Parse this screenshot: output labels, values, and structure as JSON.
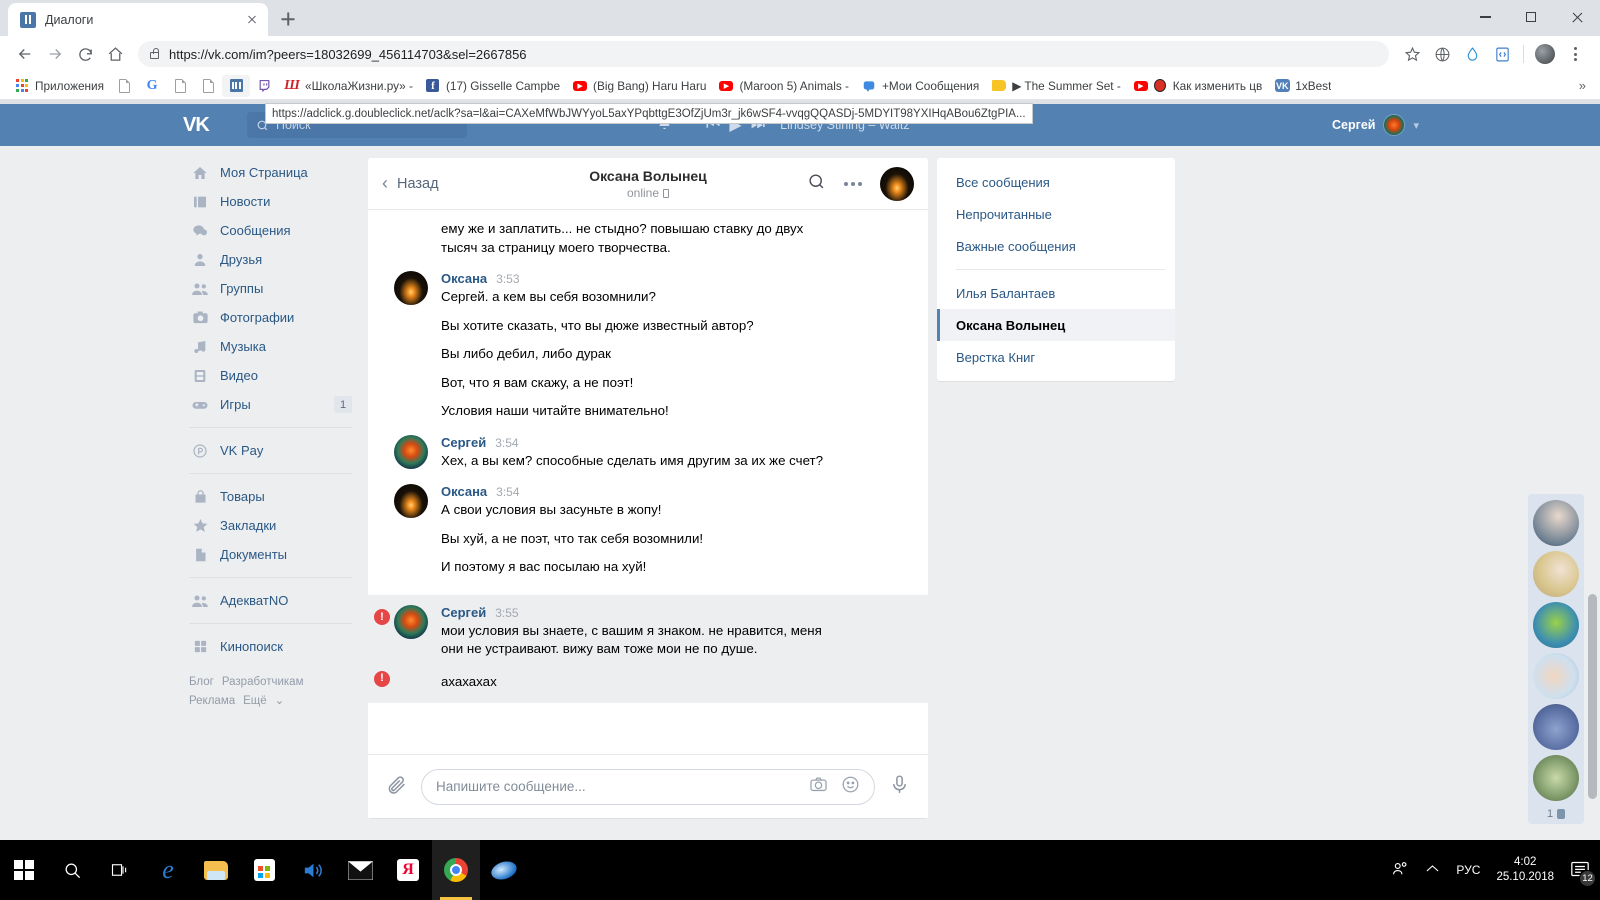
{
  "browser": {
    "tab": {
      "title": "Диалоги",
      "favicon": "vk-favicon"
    },
    "new_tab_label": "+",
    "url": "https://vk.com/im?peers=18032699_456114703&sel=2667856",
    "link_preview": "https://adclick.g.doubleclick.net/aclk?sa=l&ai=CAXeMfWbJWYyoL5axYPqbttgE3OfZjUm3r_jk6wSF4-vvqgQQASDj-5MDYIT98YXIHqABou6ZtgPIA...",
    "window_controls": {
      "minimize": "minimize-icon",
      "maximize": "maximize-icon",
      "close": "close-icon"
    },
    "bookmarks": [
      {
        "label": "Приложения",
        "icon": "apps-grid-icon"
      },
      {
        "label": "",
        "icon": "doc-icon"
      },
      {
        "label": "",
        "icon": "google-icon"
      },
      {
        "label": "",
        "icon": "doc-icon"
      },
      {
        "label": "",
        "icon": "doc-icon"
      },
      {
        "label": "",
        "icon": "vk-blue-icon"
      },
      {
        "label": "",
        "icon": "twitch-icon"
      },
      {
        "label": "«ШколаЖизни.ру» -",
        "icon": "shkolazhizni-icon"
      },
      {
        "label": "(17) Gisselle Campbe",
        "icon": "facebook-icon"
      },
      {
        "label": "(Big Bang) Haru Haru",
        "icon": "youtube-icon"
      },
      {
        "label": "(Maroon 5) Animals -",
        "icon": "youtube-icon"
      },
      {
        "label": "+Мои Сообщения",
        "icon": "message-icon"
      },
      {
        "label": "▶ The Summer Set -",
        "icon": "folder-icon"
      },
      {
        "label": "Как изменить цв",
        "icon": "youtube-icon"
      },
      {
        "label": "1xBest",
        "icon": "vk-icon"
      }
    ],
    "toolbar_icons": [
      "back-icon",
      "forward-icon",
      "reload-icon",
      "home-icon",
      "star-icon",
      "globe-icon",
      "droplet-icon",
      "code-icon",
      "profile-avatar",
      "menu-dots-icon"
    ]
  },
  "vk": {
    "header": {
      "logo": "vk-logo",
      "search_placeholder": "Поиск",
      "notifications_icon": "bell-icon",
      "player": {
        "prev": "prev-icon",
        "play": "play-icon",
        "next": "next-icon",
        "track": "Lindsey Stirling – Waltz"
      },
      "user_name": "Сергей",
      "user_chevron": "chevron-down-icon"
    },
    "left_nav": {
      "items": [
        {
          "label": "Моя Страница",
          "icon": "home-icon",
          "badge": ""
        },
        {
          "label": "Новости",
          "icon": "news-icon",
          "badge": ""
        },
        {
          "label": "Сообщения",
          "icon": "messages-icon",
          "badge": ""
        },
        {
          "label": "Друзья",
          "icon": "friends-icon",
          "badge": ""
        },
        {
          "label": "Группы",
          "icon": "groups-icon",
          "badge": ""
        },
        {
          "label": "Фотографии",
          "icon": "photos-icon",
          "badge": ""
        },
        {
          "label": "Музыка",
          "icon": "music-icon",
          "badge": ""
        },
        {
          "label": "Видео",
          "icon": "video-icon",
          "badge": ""
        },
        {
          "label": "Игры",
          "icon": "games-icon",
          "badge": "1"
        }
      ],
      "group2": [
        {
          "label": "VK Pay",
          "icon": "vkpay-icon",
          "badge": ""
        }
      ],
      "group3": [
        {
          "label": "Товары",
          "icon": "market-icon",
          "badge": ""
        },
        {
          "label": "Закладки",
          "icon": "bookmarks-star-icon",
          "badge": ""
        },
        {
          "label": "Документы",
          "icon": "documents-icon",
          "badge": ""
        }
      ],
      "group4": [
        {
          "label": "АдекватNO",
          "icon": "community-icon",
          "badge": ""
        }
      ],
      "group5": [
        {
          "label": "Кинопоиск",
          "icon": "apps-squares-icon",
          "badge": ""
        }
      ],
      "footer_links": [
        "Блог",
        "Разработчикам",
        "Реклама",
        "Ещё"
      ],
      "footer_chevron": "chevron-down-icon"
    },
    "chat": {
      "back_label": "Назад",
      "title": "Оксана Волынец",
      "status": "online",
      "status_device_icon": "mobile-icon",
      "search_icon": "search-icon",
      "more_icon": "more-dots-icon",
      "header_avatar": "oksana-avatar",
      "cut_message_top": "ему же и заплатить... не стыдно? повышаю ставку до двух",
      "cut_message_top2": "тысяч за страницу моего творчества.",
      "messages": [
        {
          "author": "Оксана",
          "time": "3:53",
          "avatar": "oksana-avatar",
          "highlight": false,
          "error": false,
          "lines": [
            "Сергей. а кем вы себя возомнили?",
            "Вы хотите сказать, что вы дюже известный автор?",
            "Вы либо дебил, либо дурак",
            "Вот, что я вам скажу, а не поэт!",
            "Условия наши читайте внимательно!"
          ]
        },
        {
          "author": "Сергей",
          "time": "3:54",
          "avatar": "sergey-avatar",
          "highlight": false,
          "error": false,
          "lines": [
            "Хех, а вы кем? способные сделать имя другим за их же счет?"
          ]
        },
        {
          "author": "Оксана",
          "time": "3:54",
          "avatar": "oksana-avatar",
          "highlight": false,
          "error": false,
          "lines": [
            "А свои условия вы засуньте в жопу!",
            "Вы хуй, а не поэт, что так себя возомнили!",
            "И поэтому я вас посылаю на хуй!"
          ]
        },
        {
          "author": "Сергей",
          "time": "3:55",
          "avatar": "sergey-avatar",
          "highlight": true,
          "error": true,
          "error_mark": "!",
          "lines": [
            "мои условия вы знаете, с вашим я знаком. не нравится, меня",
            "они не устраивают. вижу вам тоже мои не по душе.",
            "ахахахах"
          ]
        }
      ],
      "composer": {
        "attach_icon": "paperclip-icon",
        "placeholder": "Напишите сообщение...",
        "camera_icon": "camera-icon",
        "emoji_icon": "smiley-icon",
        "mic_icon": "microphone-icon"
      }
    },
    "conversations": {
      "filters": [
        "Все сообщения",
        "Непрочитанные",
        "Важные сообщения"
      ],
      "items": [
        {
          "label": "Илья Балантаев",
          "active": false
        },
        {
          "label": "Оксана Волынец",
          "active": true
        },
        {
          "label": "Верстка Книг",
          "active": false
        }
      ]
    },
    "friends_strip": {
      "avatars": [
        "friend-avatar-1",
        "friend-avatar-2",
        "friend-avatar-3",
        "friend-avatar-4",
        "friend-avatar-5",
        "friend-avatar-6"
      ],
      "count": "1",
      "count_icon": "online-icon"
    }
  },
  "taskbar": {
    "items": [
      {
        "name": "start-button",
        "icon": "windows-logo-icon"
      },
      {
        "name": "search-button",
        "icon": "search-icon"
      },
      {
        "name": "task-view-button",
        "icon": "task-view-icon"
      },
      {
        "name": "edge-button",
        "icon": "edge-icon"
      },
      {
        "name": "explorer-button",
        "icon": "folder-icon"
      },
      {
        "name": "store-button",
        "icon": "store-icon"
      },
      {
        "name": "media-button",
        "icon": "speaker-icon"
      },
      {
        "name": "mail-button",
        "icon": "mail-icon"
      },
      {
        "name": "yandex-button",
        "icon": "yandex-icon"
      },
      {
        "name": "chrome-button",
        "icon": "chrome-icon"
      },
      {
        "name": "opera-button",
        "icon": "opera-icon"
      }
    ],
    "tray": {
      "people_icon": "people-icon",
      "chevron_icon": "chevron-up-icon",
      "language": "РУС",
      "time": "4:02",
      "date": "25.10.2018",
      "notification_icon": "notification-icon",
      "notification_count": "12"
    }
  }
}
